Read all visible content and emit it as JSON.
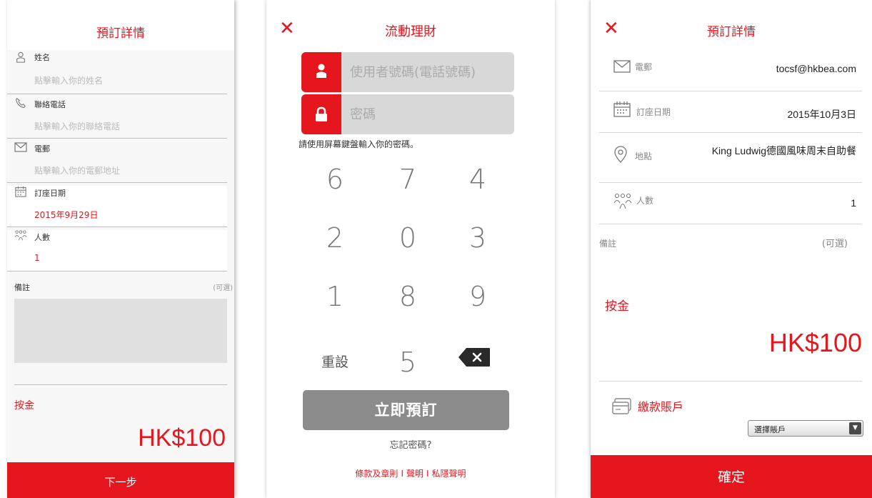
{
  "screen1": {
    "title": "預訂詳情",
    "fields": [
      {
        "label": "姓名",
        "value": "點擊輸入你的姓名",
        "icon": "user-icon"
      },
      {
        "label": "聯絡電話",
        "value": "點擊輸入你的聯絡電話",
        "icon": "phone-icon"
      },
      {
        "label": "電郵",
        "value": "點擊輸入你的電郵地址",
        "icon": "mail-icon"
      },
      {
        "label": "訂座日期",
        "value": "2015年9月29日",
        "icon": "calendar-icon"
      },
      {
        "label": "人數",
        "value": "1",
        "icon": "people-icon"
      }
    ],
    "remark_label": "備註",
    "remark_optional": "(可選)",
    "deposit_label": "按金",
    "price": "HK$100",
    "next_button": "下一步"
  },
  "screen2": {
    "title": "流動理財",
    "username_placeholder": "使用者號碼(電話號碼)",
    "password_placeholder": "密碼",
    "hint": "請使用屏幕鍵盤輸入你的密碼。",
    "keys": [
      "6",
      "7",
      "4",
      "2",
      "0",
      "3",
      "1",
      "8",
      "9",
      "重設",
      "5"
    ],
    "book_button": "立即預訂",
    "forgot": "忘記密碼?",
    "links": [
      "條款及章則",
      "聲明",
      "私隱聲明"
    ],
    "link_separator": "I"
  },
  "screen3": {
    "title": "預訂詳情",
    "rows": [
      {
        "label": "電郵",
        "value": "tocsf@hkbea.com",
        "icon": "mail-icon"
      },
      {
        "label": "訂座日期",
        "value": "2015年10月3日",
        "icon": "calendar-icon"
      },
      {
        "label": "地點",
        "value": "King Ludwig德國風味周末自助餐",
        "icon": "location-icon"
      },
      {
        "label": "人數",
        "value": "1",
        "icon": "people-icon"
      }
    ],
    "remark_label": "備註",
    "remark_optional": "(可選)",
    "deposit_label": "按金",
    "price": "HK$100",
    "account_label": "繳款賬戶",
    "account_select": "選擇賬戶",
    "confirm_button": "確定"
  },
  "colors": {
    "accent": "#e5161d",
    "button_gray": "#8c8c8c",
    "field_gray": "#d8d8d8"
  }
}
